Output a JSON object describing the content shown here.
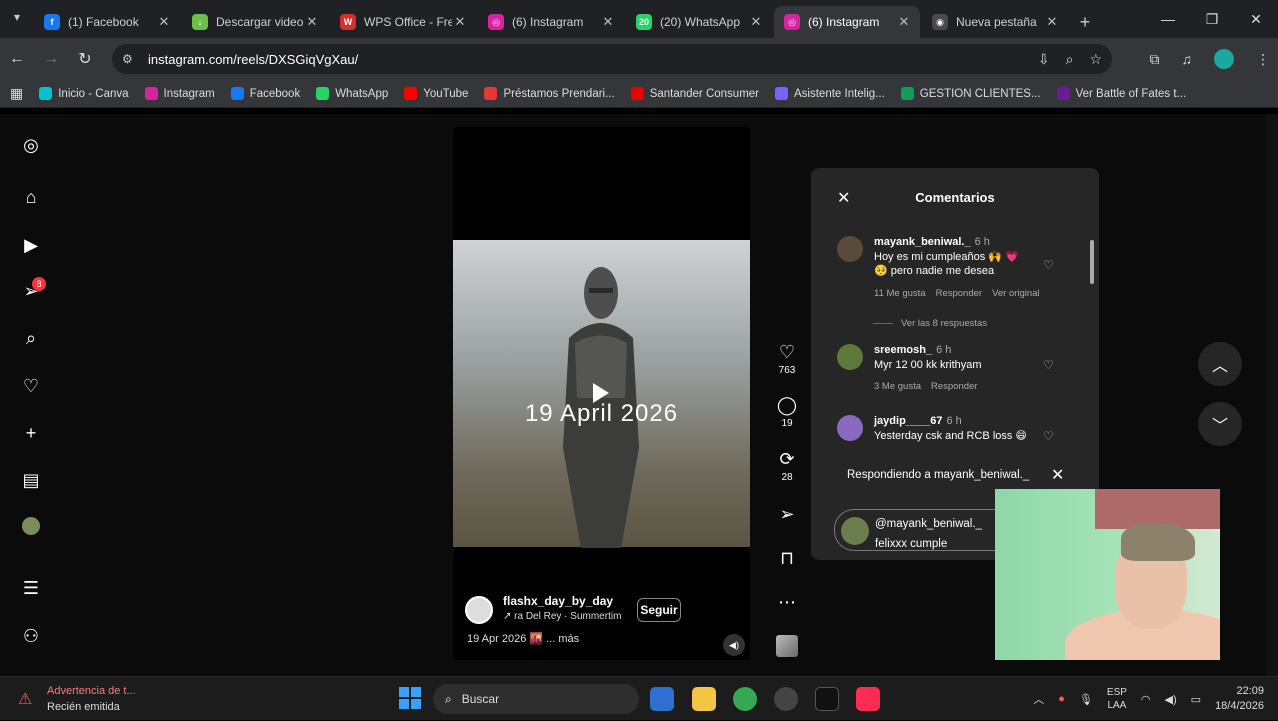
{
  "browser": {
    "tabs": [
      {
        "title": "(1) Facebook",
        "icon": "facebook-icon",
        "color": "#1877f2",
        "glyph": "f"
      },
      {
        "title": "Descargar video",
        "icon": "download-icon",
        "color": "#6bc045",
        "glyph": "↓"
      },
      {
        "title": "WPS Office - Fre",
        "icon": "wps-icon",
        "color": "#d32f2f",
        "glyph": "W"
      },
      {
        "title": "(6) Instagram",
        "icon": "instagram-icon",
        "color": "#d6249f",
        "glyph": "◎"
      },
      {
        "title": "(20) WhatsApp",
        "icon": "whatsapp-icon",
        "color": "#25d366",
        "glyph": "20"
      },
      {
        "title": "(6) Instagram",
        "icon": "instagram-icon",
        "color": "#d6249f",
        "glyph": "◎",
        "active": true
      },
      {
        "title": "Nueva pestaña",
        "icon": "chrome-icon",
        "color": "#4a4a4a",
        "glyph": "◉"
      }
    ],
    "url": "instagram.com/reels/DXSGiqVgXau/",
    "bookmarks": [
      {
        "label": "Inicio - Canva",
        "color": "#00c4cc"
      },
      {
        "label": "Instagram",
        "color": "#d6249f"
      },
      {
        "label": "Facebook",
        "color": "#1877f2"
      },
      {
        "label": "WhatsApp",
        "color": "#25d366"
      },
      {
        "label": "YouTube",
        "color": "#ff0000"
      },
      {
        "label": "Préstamos Prendari...",
        "color": "#e53935"
      },
      {
        "label": "Santander Consumer",
        "color": "#ec0000"
      },
      {
        "label": "Asistente Intelig...",
        "color": "#7b61ff"
      },
      {
        "label": "GESTION CLIENTES...",
        "color": "#0f9d58"
      },
      {
        "label": "Ver Battle of Fates t...",
        "color": "#6a1b9a"
      }
    ]
  },
  "sidebar": {
    "notification_count": "8"
  },
  "reel": {
    "overlay_text": "19 April 2026",
    "username": "flashx_day_by_day",
    "audio": "↗ ra Del Rey · Summertim",
    "follow_label": "Seguir",
    "caption": "19 Apr 2026 🌇 ... más",
    "likes": "763",
    "comments": "19",
    "reposts": "28"
  },
  "comments_panel": {
    "title": "Comentarios",
    "items": [
      {
        "user": "mayank_beniwal._",
        "time": "6 h",
        "text": "Hoy es mi cumpleaños 🙌 💗 🥺 pero nadie me desea",
        "likes": "11 Me gusta",
        "reply": "Responder",
        "original": "Ver original",
        "avatar_color": "#5a4a3a"
      },
      {
        "user": "sreemosh_",
        "time": "6 h",
        "text": "Myr 12 00 kk krithyam",
        "likes": "3 Me gusta",
        "reply": "Responder",
        "avatar_color": "#5d7a3a"
      },
      {
        "user": "jaydip____67",
        "time": "6 h",
        "text": "Yesterday csk and RCB loss 😄",
        "avatar_color": "#8a6abf"
      }
    ],
    "view_replies": "Ver las 8 respuestas",
    "replying_to": "Respondiendo a mayank_beniwal._",
    "input_value": "@mayank_beniwal._ felixxx cumple"
  },
  "taskbar": {
    "notification_title": "Advertencia de t...",
    "notification_sub": "Recién emitida",
    "search_placeholder": "Buscar",
    "lang_1": "ESP",
    "lang_2": "LAA",
    "time": "22:09",
    "date": "18/4/2026"
  }
}
